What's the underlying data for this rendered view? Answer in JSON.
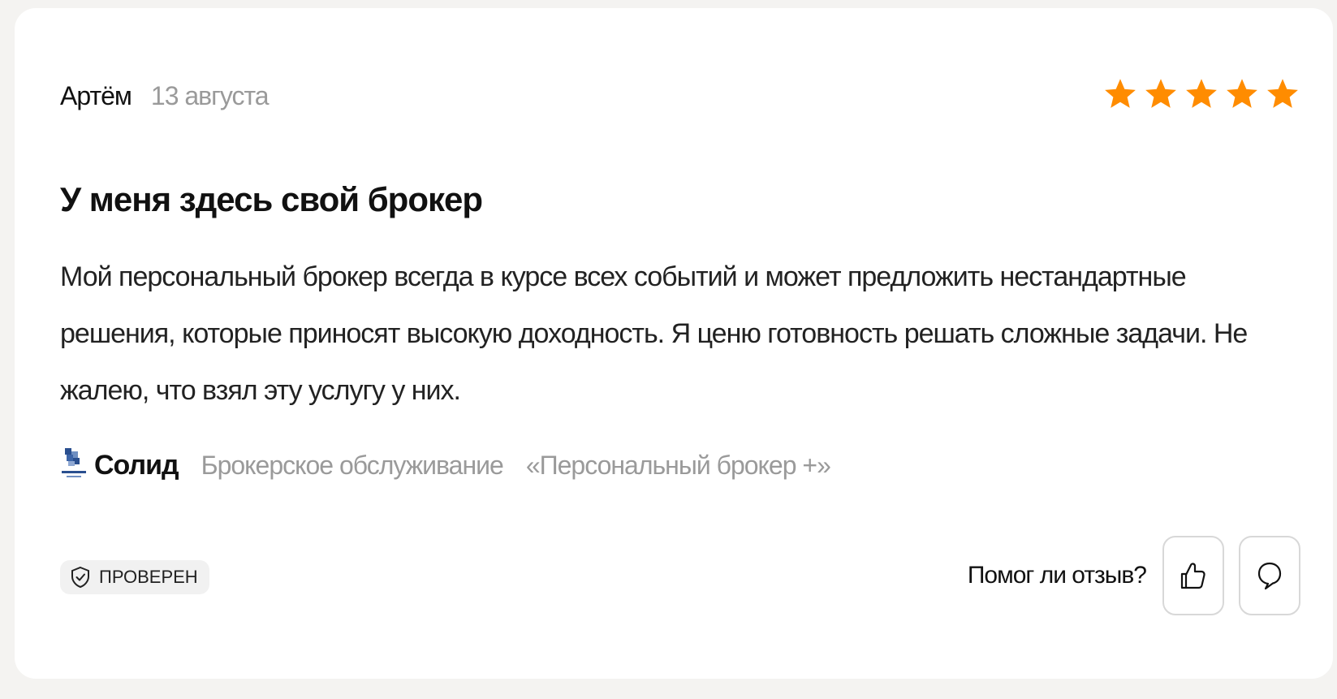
{
  "review": {
    "author": "Артём",
    "date": "13 августа",
    "rating": 5,
    "rating_max": 5,
    "title": "У меня здесь свой брокер",
    "text": "Мой персональный брокер всегда в курсе всех событий и может предложить нестандартные решения, которые приносят высокую доходность. Я ценю готовность решать сложные задачи. Не жалею, что взял эту услугу у них.",
    "company": "Солид",
    "service": "Брокерское обслуживание",
    "product": "«Персональный брокер +»",
    "badge": "ПРОВЕРЕН",
    "helpful_question": "Помог ли отзыв?"
  },
  "icons": {
    "star": "star-icon",
    "logo": "company-logo-icon",
    "badge": "shield-check-icon",
    "like": "thumbs-up-icon",
    "comment": "comment-icon"
  },
  "colors": {
    "star": "#ff8c00",
    "muted_text": "#9a9a9a",
    "card_bg": "#ffffff",
    "page_bg": "#f4f3f1"
  }
}
